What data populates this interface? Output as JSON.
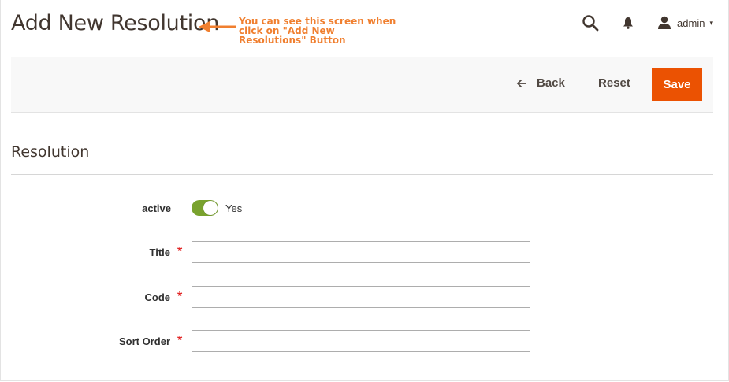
{
  "page": {
    "title": "Add New Resolution",
    "annotation": "You can see this screen when click on \"Add New Resolutions\" Button"
  },
  "header": {
    "search_icon": "search-icon",
    "notifications_icon": "bell-icon",
    "user_label": "admin",
    "user_caret": "▾"
  },
  "actions": {
    "back_label": "Back",
    "reset_label": "Reset",
    "save_label": "Save"
  },
  "section": {
    "title": "Resolution"
  },
  "form": {
    "active": {
      "label": "active",
      "value_label": "Yes",
      "enabled": true
    },
    "title": {
      "label": "Title",
      "required_mark": "*",
      "value": ""
    },
    "code": {
      "label": "Code",
      "required_mark": "*",
      "value": ""
    },
    "sort_order": {
      "label": "Sort Order",
      "required_mark": "*",
      "value": ""
    }
  },
  "colors": {
    "save_button": "#eb5202",
    "toggle_on": "#79a22e",
    "annotation": "#f07f2f",
    "required": "#e22626"
  }
}
